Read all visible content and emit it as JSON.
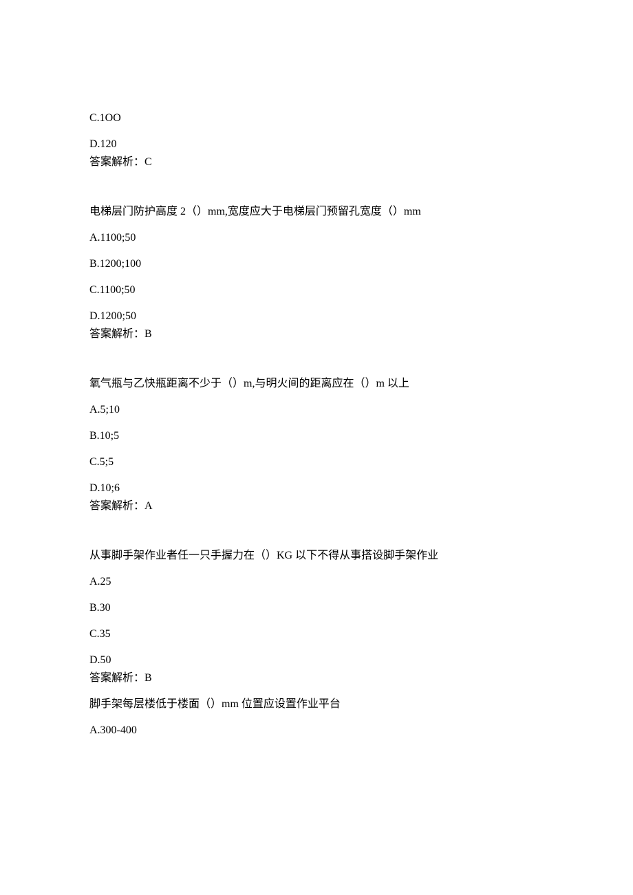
{
  "block1": {
    "option_c": "C.1OO",
    "option_d": "D.120",
    "answer": "答案解析：C"
  },
  "question2": {
    "text": "电梯层门防护高度 2（）mm,宽度应大于电梯层门预留孔宽度（）mm",
    "option_a": "A.1100;50",
    "option_b": "B.1200;100",
    "option_c": "C.1100;50",
    "option_d": "D.1200;50",
    "answer": "答案解析：B"
  },
  "question3": {
    "text": "氧气瓶与乙快瓶距离不少于（）m,与明火间的距离应在（）m 以上",
    "option_a": "A.5;10",
    "option_b": "B.10;5",
    "option_c": "C.5;5",
    "option_d": "D.10;6",
    "answer": "答案解析：A"
  },
  "question4": {
    "text": "从事脚手架作业者任一只手握力在（）KG 以下不得从事搭设脚手架作业",
    "option_a": "A.25",
    "option_b": "B.30",
    "option_c": "C.35",
    "option_d": "D.50",
    "answer": "答案解析：B"
  },
  "question5": {
    "text": "脚手架每层楼低于楼面（）mm 位置应设置作业平台",
    "option_a": "A.300-400"
  }
}
